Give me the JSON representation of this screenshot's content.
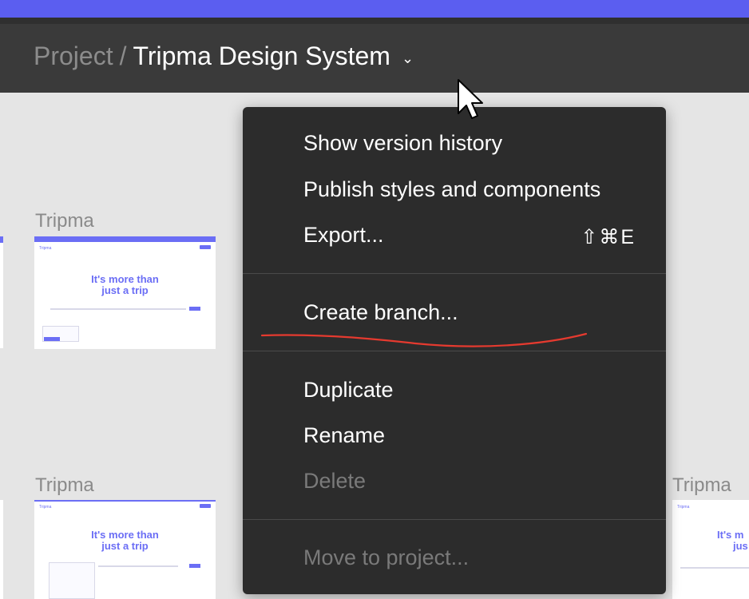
{
  "breadcrumb": {
    "project": "Project",
    "separator": "/",
    "title": "Tripma Design System",
    "chevron": "⌄"
  },
  "files": [
    {
      "label": "Tripma",
      "hero_line1": "It's more than",
      "hero_line2": "just a trip",
      "nav": "Tripma"
    },
    {
      "label": "Tripma",
      "hero_line1": "It's more than",
      "hero_line2": "just a trip",
      "nav": "Tripma"
    },
    {
      "label": "Tripma",
      "hero_line1": "It's m",
      "hero_line2": "jus",
      "nav": "Tripma"
    }
  ],
  "menu": {
    "items": [
      {
        "label": "Show version history"
      },
      {
        "label": "Publish styles and components"
      },
      {
        "label": "Export...",
        "shortcut": "⇧⌘E"
      },
      {
        "label": "Create branch..."
      },
      {
        "label": "Duplicate"
      },
      {
        "label": "Rename"
      },
      {
        "label": "Delete",
        "disabled": true
      },
      {
        "label": "Move to project...",
        "disabled": true
      }
    ]
  },
  "icons": {
    "chevron": "chevron-down-icon",
    "cursor": "mouse-cursor-icon"
  },
  "colors": {
    "accent": "#5b5ef0",
    "header_bg": "#3a3a3a",
    "menu_bg": "#2c2c2c",
    "annotation": "#e53a2f"
  }
}
